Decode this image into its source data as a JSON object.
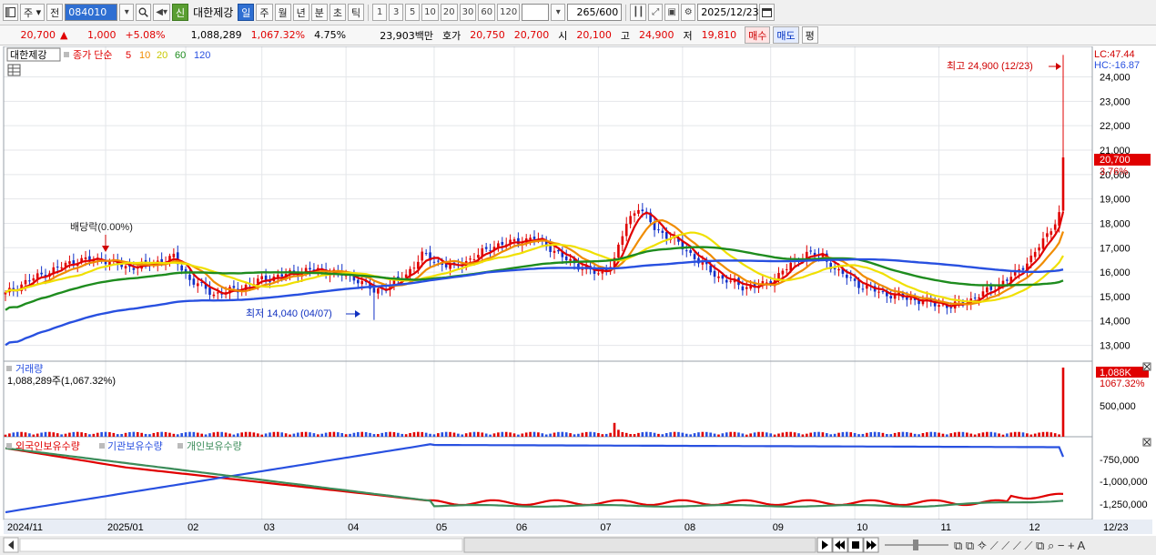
{
  "toolbar": {
    "market_label": "주",
    "prev_label": "전",
    "code": "084010",
    "name_badge": "신",
    "name": "대한제강",
    "periods": [
      "일",
      "주",
      "월",
      "년",
      "분",
      "초",
      "틱"
    ],
    "active_period": "일",
    "intervals": [
      "1",
      "3",
      "5",
      "10",
      "20",
      "30",
      "60",
      "120"
    ],
    "count": "265",
    "count_max": "/600",
    "date": "2025/12/23"
  },
  "quote": {
    "price": "20,700",
    "arrow": "▲",
    "change": "1,000",
    "change_pct": "+5.08%",
    "volume": "1,088,289",
    "volume_ratio": "1,067.32%",
    "turnover": "4.75%",
    "trade_value": "23,903백만",
    "bid_label": "호가",
    "bid1": "20,750",
    "bid2": "20,700",
    "open_label": "시",
    "open": "20,100",
    "high_label": "고",
    "high": "24,900",
    "low_label": "저",
    "low": "19,810",
    "buy_label": "매수",
    "sell_label": "매도",
    "avg_label": "평"
  },
  "legend": {
    "name": "대한제강",
    "ma_label": "종가 단순",
    "ma_periods": [
      "5",
      "10",
      "20",
      "60",
      "120"
    ],
    "ma_colors": [
      "#e00000",
      "#f08c00",
      "#f0e000",
      "#1e8c1e",
      "#2850e0"
    ]
  },
  "annotations": {
    "high": "최고 24,900 (12/23)",
    "low": "최저 14,040 (04/07)",
    "dividend": "배당락(0.00%)",
    "lc": "LC:47.44",
    "hc": "HC:-16.87",
    "price_tag": "20,700",
    "pct_tag": "3.76%"
  },
  "volume_panel": {
    "title": "거래량",
    "value": "1,088,289주(1,067.32%)",
    "tag_value": "1,088K",
    "tag_pct": "1067.32%"
  },
  "holdings_panel": {
    "series": [
      "외국인보유수량",
      "기관보유수량",
      "개인보유수량"
    ],
    "colors": [
      "#e00000",
      "#2850e0",
      "#3c8c5a"
    ],
    "ticks": [
      "-750,000",
      "-1,000,000",
      "-1,250,000"
    ]
  },
  "chart_data": {
    "type": "candlestick",
    "price_ticks": [
      24000,
      23000,
      22000,
      21000,
      20000,
      19000,
      18000,
      17000,
      16000,
      15000,
      14000,
      13000
    ],
    "price_range": [
      12350,
      25250
    ],
    "volume_ticks": [
      "500,000"
    ],
    "months": [
      "2024/11",
      "2025/01",
      "02",
      "03",
      "04",
      "05",
      "06",
      "07",
      "08",
      "09",
      "10",
      "11",
      "12"
    ],
    "last_date": "12/23",
    "close_keypoints": [
      [
        0,
        15100
      ],
      [
        5,
        15600
      ],
      [
        12,
        16100
      ],
      [
        18,
        16500
      ],
      [
        25,
        16500
      ],
      [
        30,
        16200
      ],
      [
        35,
        16300
      ],
      [
        42,
        16600
      ],
      [
        46,
        15700
      ],
      [
        52,
        15100
      ],
      [
        58,
        15300
      ],
      [
        64,
        15700
      ],
      [
        70,
        15900
      ],
      [
        76,
        16100
      ],
      [
        82,
        16000
      ],
      [
        88,
        15700
      ],
      [
        92,
        15200
      ],
      [
        95,
        15400
      ],
      [
        100,
        15900
      ],
      [
        104,
        16700
      ],
      [
        108,
        16400
      ],
      [
        112,
        16200
      ],
      [
        118,
        16700
      ],
      [
        122,
        17100
      ],
      [
        126,
        17200
      ],
      [
        132,
        17400
      ],
      [
        136,
        17000
      ],
      [
        140,
        16500
      ],
      [
        144,
        16200
      ],
      [
        148,
        15900
      ],
      [
        152,
        16500
      ],
      [
        155,
        18000
      ],
      [
        158,
        18700
      ],
      [
        162,
        17800
      ],
      [
        166,
        17400
      ],
      [
        170,
        16900
      ],
      [
        174,
        16300
      ],
      [
        178,
        15800
      ],
      [
        184,
        15400
      ],
      [
        190,
        15500
      ],
      [
        196,
        16300
      ],
      [
        200,
        16800
      ],
      [
        204,
        16600
      ],
      [
        208,
        16000
      ],
      [
        214,
        15400
      ],
      [
        220,
        15100
      ],
      [
        226,
        14900
      ],
      [
        232,
        14700
      ],
      [
        236,
        14600
      ],
      [
        240,
        14800
      ],
      [
        246,
        15300
      ],
      [
        252,
        15900
      ],
      [
        256,
        16600
      ],
      [
        260,
        17500
      ],
      [
        263,
        18400
      ],
      [
        264,
        20700
      ]
    ]
  }
}
